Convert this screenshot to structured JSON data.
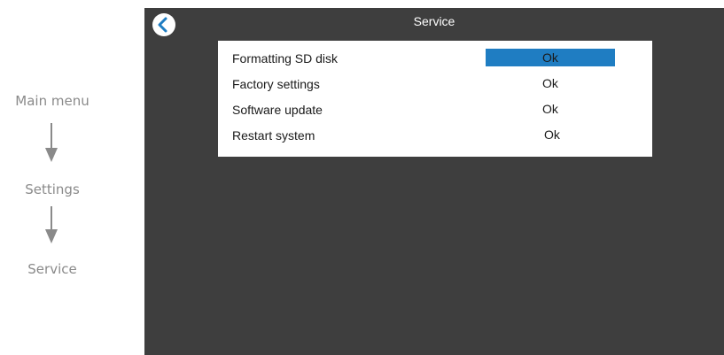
{
  "breadcrumb": {
    "items": [
      "Main menu",
      "Settings",
      "Service"
    ]
  },
  "screen": {
    "title": "Service",
    "back_icon": "chevron-left-icon",
    "rows": [
      {
        "label": "Formatting SD disk",
        "action": "Ok",
        "selected": true
      },
      {
        "label": "Factory settings",
        "action": "Ok",
        "selected": false
      },
      {
        "label": "Software update",
        "action": "Ok",
        "selected": false
      },
      {
        "label": "Restart system",
        "action": "Ok",
        "selected": false
      }
    ]
  },
  "colors": {
    "screen_bg": "#3e3e3e",
    "accent": "#1f7dc2",
    "breadcrumb_text": "#8a8a8a"
  }
}
